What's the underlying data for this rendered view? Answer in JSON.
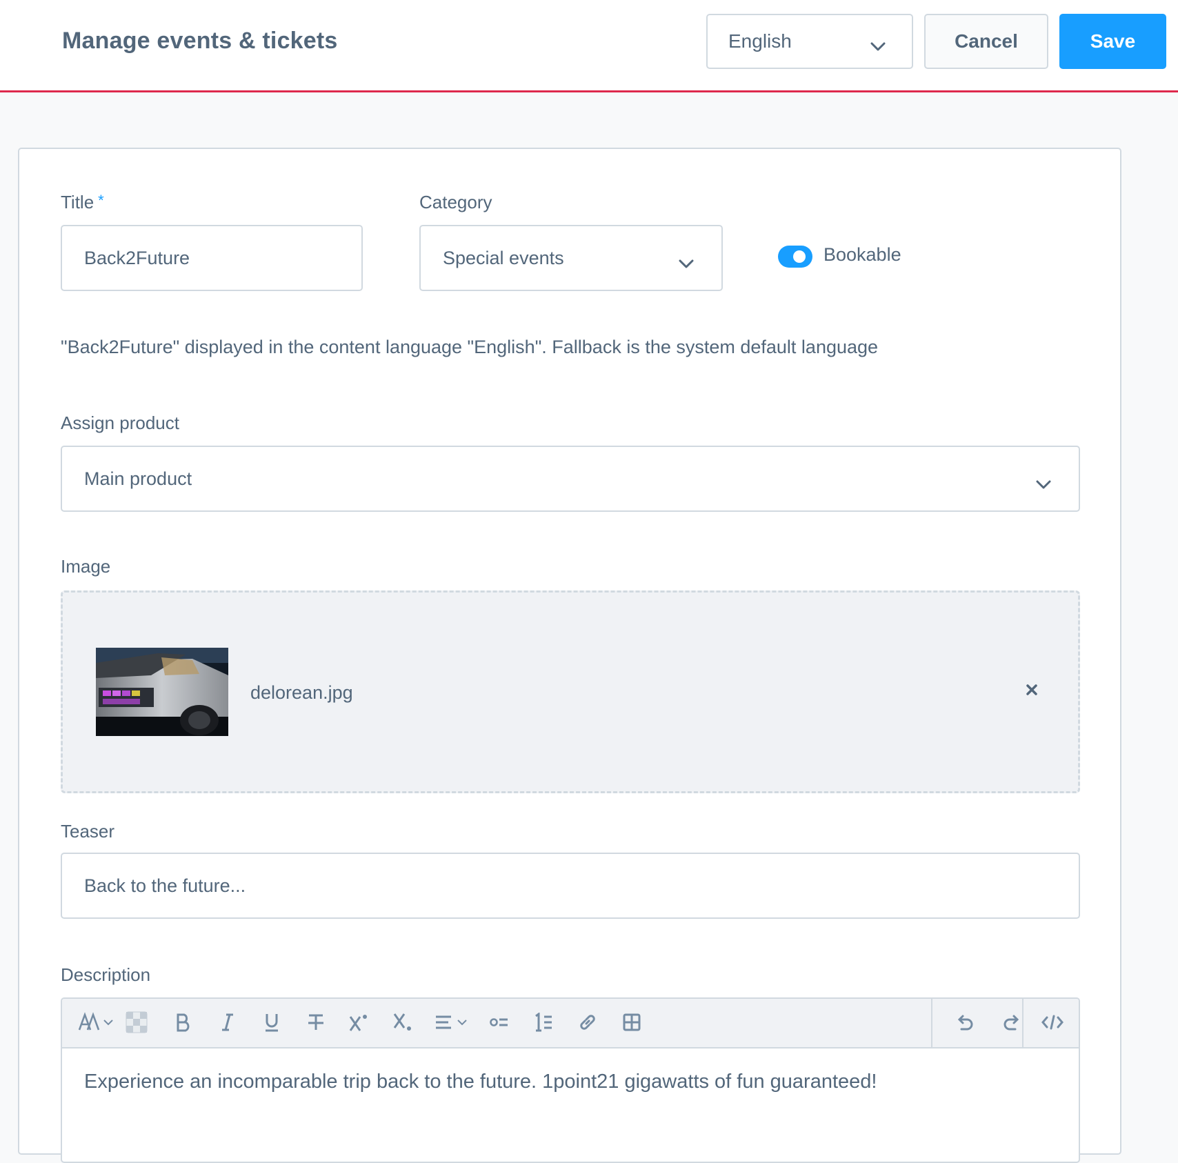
{
  "header": {
    "title": "Manage events & tickets",
    "language": "English",
    "cancel_label": "Cancel",
    "save_label": "Save"
  },
  "form": {
    "title_label": "Title",
    "title_required_marker": "*",
    "title_value": "Back2Future",
    "category_label": "Category",
    "category_value": "Special events",
    "bookable_label": "Bookable",
    "bookable_on": true,
    "hint": "\"Back2Future\" displayed in the content language \"English\". Fallback is the system default language",
    "assign_product_label": "Assign product",
    "assign_product_value": "Main product",
    "image_label": "Image",
    "image_filename": "delorean.jpg",
    "teaser_label": "Teaser",
    "teaser_value": "Back to the future...",
    "description_label": "Description",
    "description_text": "Experience an incomparable trip back to the future. 1point21 gigawatts of fun guaranteed!"
  },
  "toolbar_icons": [
    "text-style-icon",
    "text-color-icon",
    "bold-icon",
    "italic-icon",
    "underline-icon",
    "strikethrough-icon",
    "superscript-icon",
    "subscript-icon",
    "align-icon",
    "unordered-list-icon",
    "ordered-list-icon",
    "link-icon",
    "table-icon",
    "undo-icon",
    "redo-icon",
    "code-view-icon"
  ],
  "colors": {
    "accent": "#189eff",
    "header_border": "#de294c",
    "text": "#52667a",
    "border": "#d1d9e0"
  }
}
